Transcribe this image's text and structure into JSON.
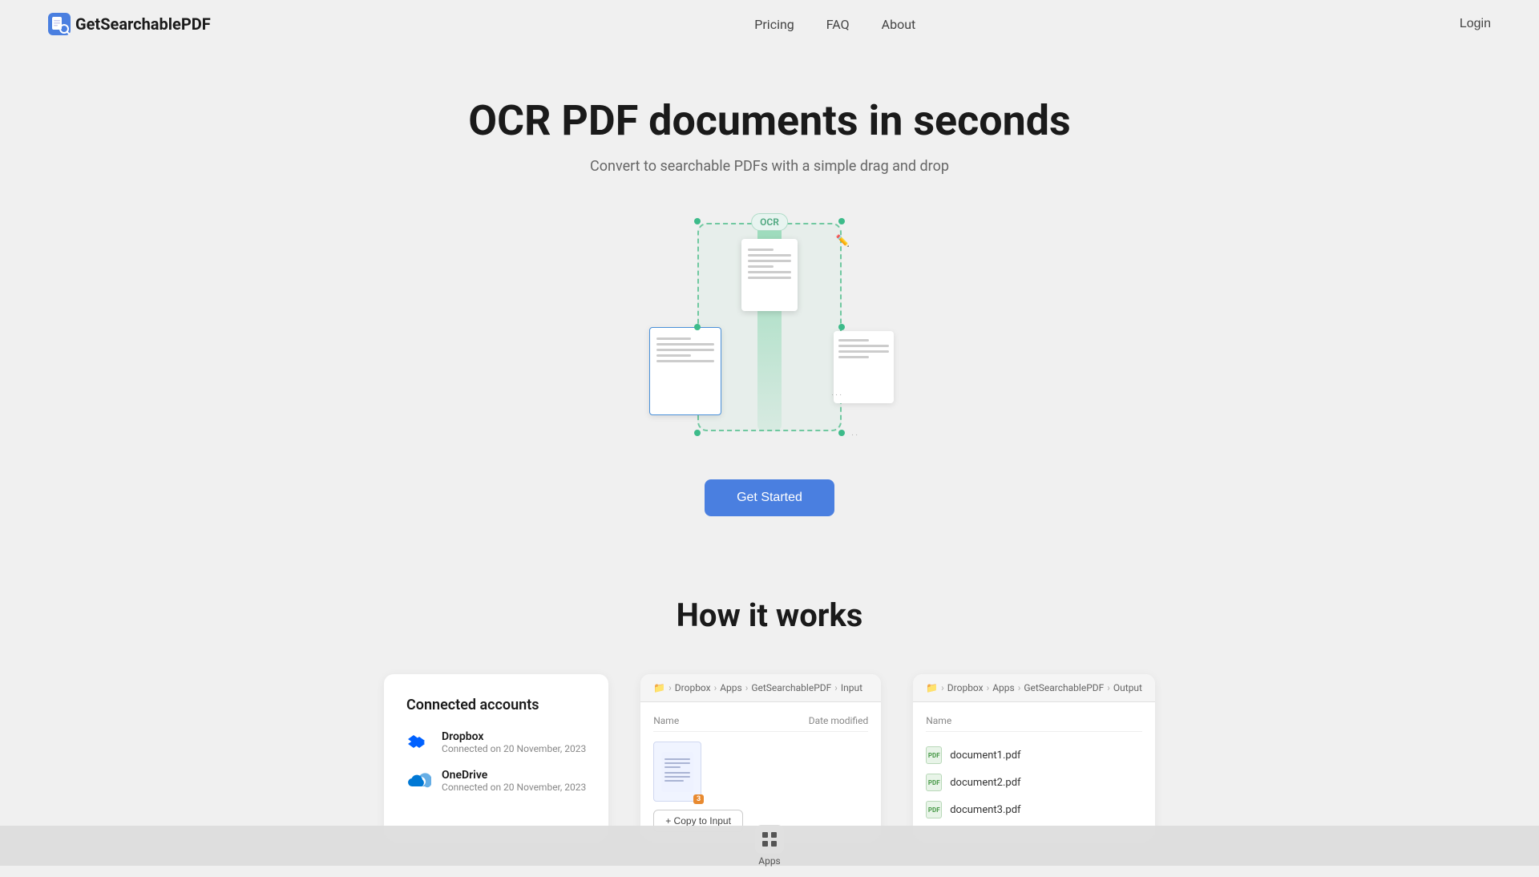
{
  "brand": {
    "logo_text": "GetSearchablePDF",
    "logo_icon": "📄"
  },
  "nav": {
    "pricing": "Pricing",
    "faq": "FAQ",
    "about": "About",
    "login": "Login"
  },
  "hero": {
    "title": "OCR PDF documents in seconds",
    "subtitle": "Convert to searchable PDFs with a simple drag and drop",
    "ocr_badge": "OCR",
    "get_started": "Get Started"
  },
  "how": {
    "title": "How it works",
    "card1": {
      "title": "Connected accounts",
      "accounts": [
        {
          "name": "Dropbox",
          "date": "Connected on 20 November, 2023",
          "icon": "dropbox"
        },
        {
          "name": "OneDrive",
          "date": "Connected on 20 November, 2023",
          "icon": "onedrive"
        }
      ]
    },
    "card2": {
      "path_parts": [
        "Dropbox",
        "Apps",
        "GetSearchablePDF",
        "Input"
      ],
      "folder_icon": "📁",
      "col_name": "Name",
      "col_date": "Date modified",
      "copy_btn": "+ Copy to Input"
    },
    "card3": {
      "path_parts": [
        "Dropbox",
        "Apps",
        "GetSearchablePDF",
        "Output"
      ],
      "folder_icon": "📁",
      "col_name": "Name",
      "files": [
        "document1.pdf",
        "document2.pdf",
        "document3.pdf"
      ]
    }
  },
  "taskbar": {
    "apps_label": "Apps"
  }
}
